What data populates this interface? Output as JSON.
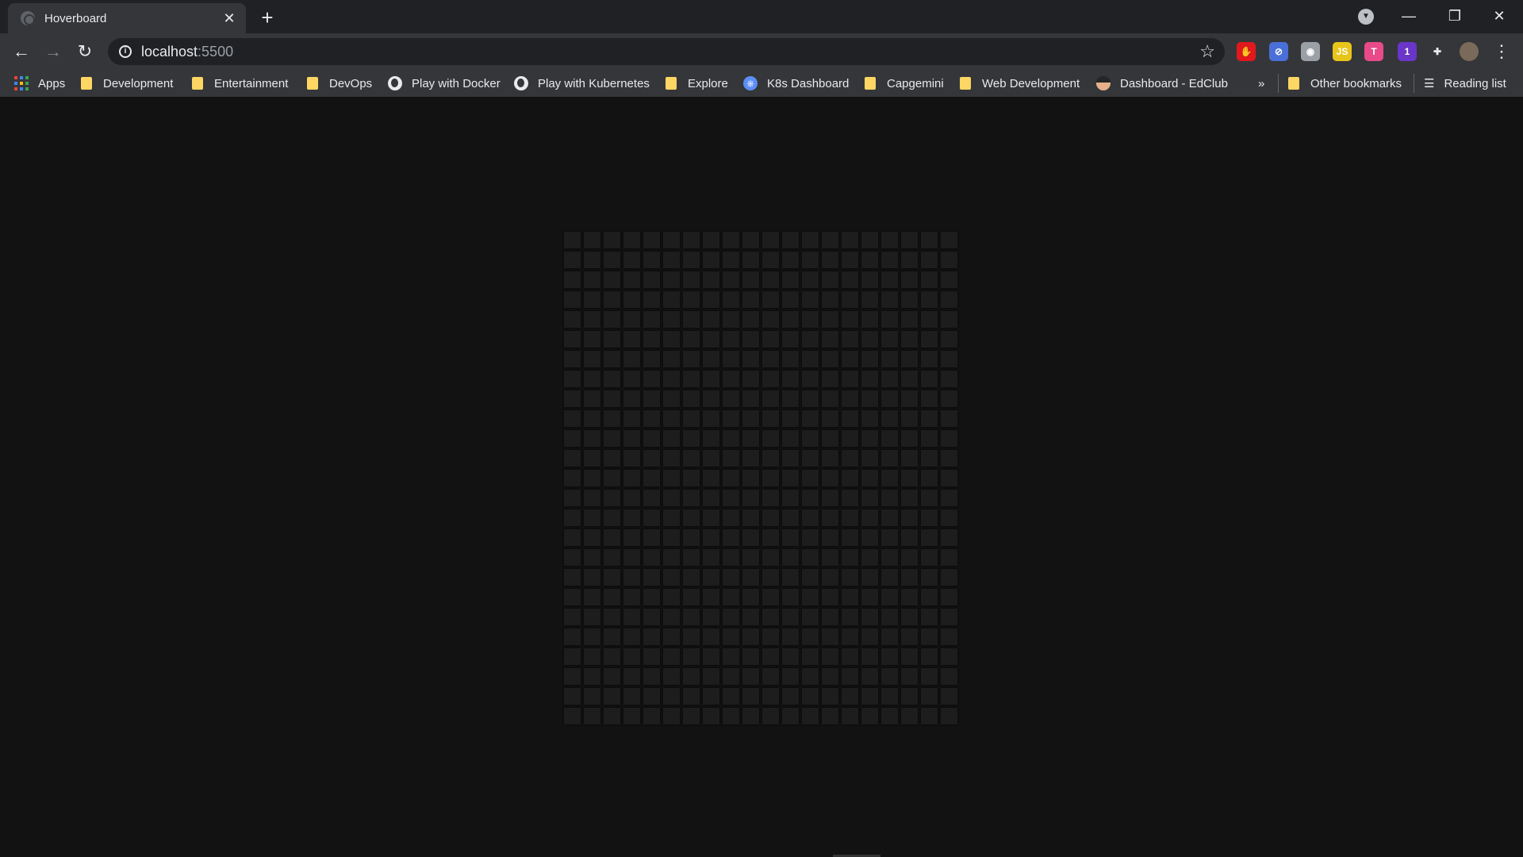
{
  "browser": {
    "tab_title": "Hoverboard",
    "tab_close_glyph": "✕",
    "new_tab_glyph": "+",
    "window_controls": [
      "—",
      "❐",
      "✕"
    ],
    "url_host": "localhost",
    "url_port": ":5500",
    "extensions": [
      {
        "name": "adblock-icon",
        "label": "✋",
        "color": "#e0191c"
      },
      {
        "name": "blocker-icon",
        "label": "⊘",
        "color": "#4a6fd8"
      },
      {
        "name": "ghost-icon",
        "label": "◉",
        "color": "#9aa0a6"
      },
      {
        "name": "js-icon",
        "label": "JS",
        "color": "#e8c51a"
      },
      {
        "name": "t-icon",
        "label": "T",
        "color": "#e84a8a"
      },
      {
        "name": "purple-ext-icon",
        "label": "1",
        "color": "#6a35c9"
      },
      {
        "name": "puzzle-icon",
        "label": "✚",
        "color": "#35363a"
      },
      {
        "name": "profile-avatar",
        "label": "",
        "color": "#7a6a5a"
      }
    ],
    "menu_glyph": "⋮"
  },
  "bookmarks": {
    "items": [
      {
        "label": "Apps",
        "icon": "apps-grid-icon"
      },
      {
        "label": "Development",
        "icon": "folder-icon"
      },
      {
        "label": "Entertainment",
        "icon": "folder-icon"
      },
      {
        "label": "DevOps",
        "icon": "folder-icon"
      },
      {
        "label": "Play with Docker",
        "icon": "globe-icon"
      },
      {
        "label": "Play with Kubernetes",
        "icon": "globe-icon"
      },
      {
        "label": "Explore",
        "icon": "folder-icon"
      },
      {
        "label": "K8s Dashboard",
        "icon": "k8s-icon"
      },
      {
        "label": "Capgemini",
        "icon": "folder-icon"
      },
      {
        "label": "Web Development",
        "icon": "folder-icon"
      },
      {
        "label": "Dashboard - EdClub",
        "icon": "edclub-avatar-icon"
      }
    ],
    "overflow": "»",
    "other_bookmarks": "Other bookmarks",
    "reading_list": "Reading list"
  },
  "board": {
    "columns": 20,
    "rows": 25,
    "square_color": "#1d1d1d",
    "background_color": "#121212"
  }
}
